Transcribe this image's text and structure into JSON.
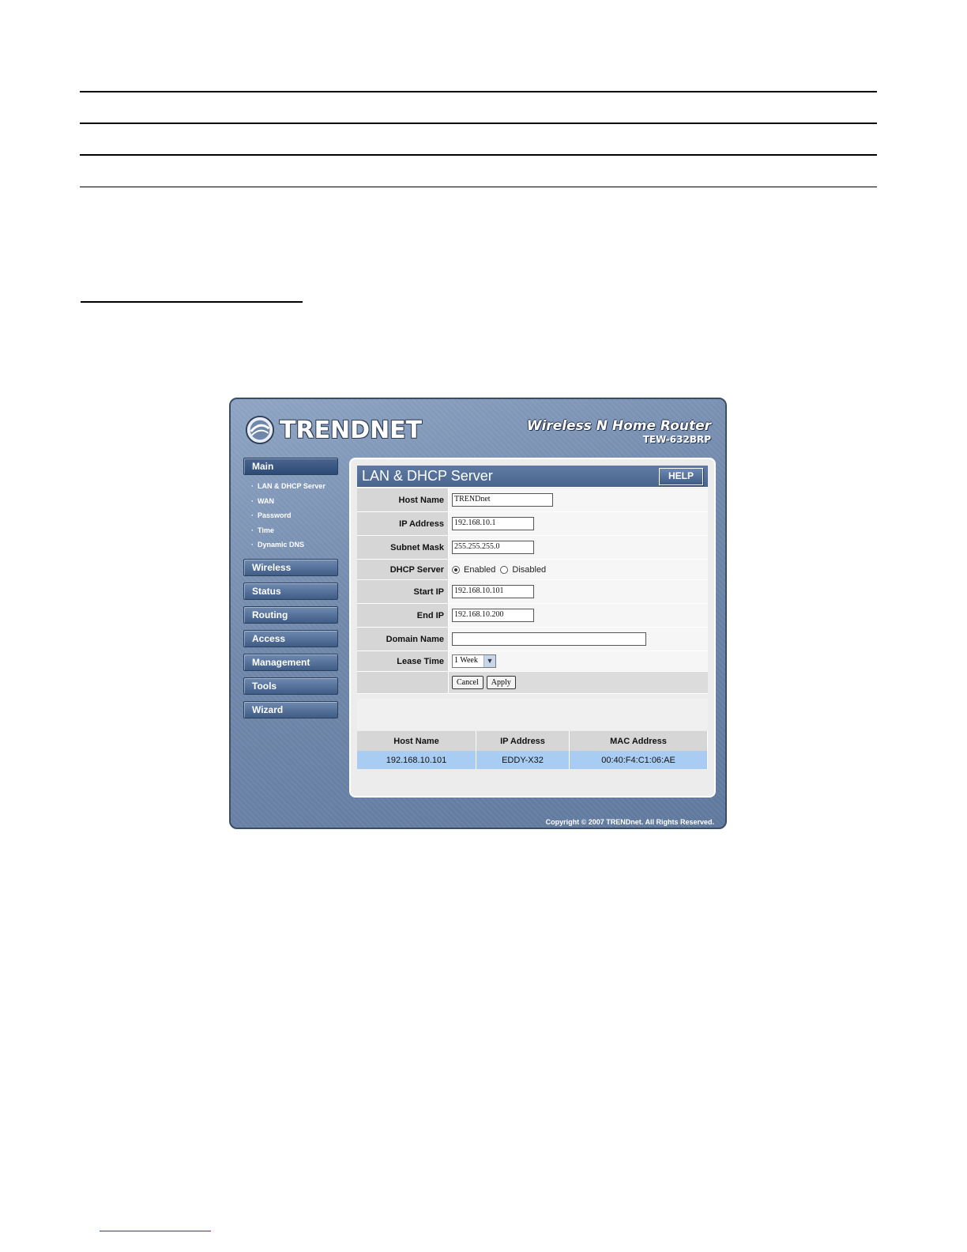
{
  "header": {
    "logo_text": "TRENDNET",
    "product_title": "Wireless N Home Router",
    "product_model": "TEW-632BRP"
  },
  "sidebar": {
    "main": "Main",
    "subitems": [
      "LAN & DHCP Server",
      "WAN",
      "Password",
      "Time",
      "Dynamic DNS"
    ],
    "items": [
      "Wireless",
      "Status",
      "Routing",
      "Access",
      "Management",
      "Tools",
      "Wizard"
    ]
  },
  "panel": {
    "title": "LAN & DHCP Server",
    "help_label": "HELP"
  },
  "form": {
    "host_name_label": "Host Name",
    "host_name_value": "TRENDnet",
    "ip_address_label": "IP Address",
    "ip_address_value": "192.168.10.1",
    "subnet_mask_label": "Subnet Mask",
    "subnet_mask_value": "255.255.255.0",
    "dhcp_server_label": "DHCP Server",
    "dhcp_enabled_label": "Enabled",
    "dhcp_disabled_label": "Disabled",
    "start_ip_label": "Start IP",
    "start_ip_value": "192.168.10.101",
    "end_ip_label": "End IP",
    "end_ip_value": "192.168.10.200",
    "domain_name_label": "Domain Name",
    "domain_name_value": "",
    "lease_time_label": "Lease Time",
    "lease_time_value": "1 Week",
    "cancel_label": "Cancel",
    "apply_label": "Apply"
  },
  "clients": {
    "headers": [
      "Host Name",
      "IP Address",
      "MAC Address"
    ],
    "rows": [
      [
        "192.168.10.101",
        "EDDY-X32",
        "00:40:F4:C1:06:AE"
      ]
    ]
  },
  "footer": {
    "copyright": "Copyright © 2007 TRENDnet. All Rights Reserved."
  }
}
